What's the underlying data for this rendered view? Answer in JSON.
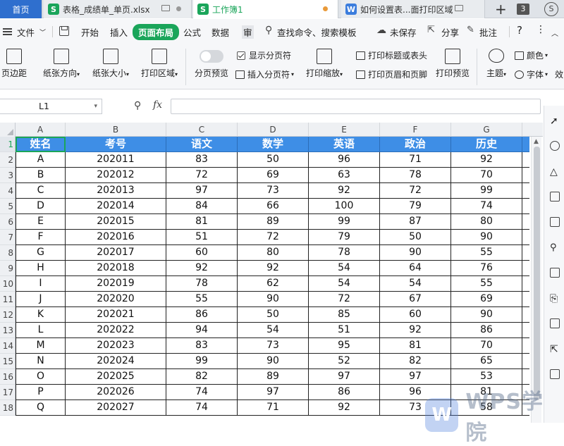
{
  "tabs": {
    "home": "首页",
    "file1": "表格_成绩单_单页.xlsx",
    "file2": "工作簿1",
    "file3": "如何设置表...面打印区域",
    "count": "3",
    "user_initial": "S"
  },
  "menu": {
    "file": "文件",
    "start": "开始",
    "insert": "插入",
    "layout": "页面布局",
    "formula": "公式",
    "data": "数据",
    "more": "审",
    "search": "查找命令、搜索模板",
    "unsaved": "未保存",
    "share": "分享",
    "comment": "批注",
    "help": "?"
  },
  "ribbon": {
    "margins": "页边距",
    "orientation": "纸张方向",
    "size": "纸张大小",
    "print_area": "打印区域",
    "page_break_preview": "分页预览",
    "show_page_break": "显示分页符",
    "insert_page_break": "插入分页符",
    "print_scale": "打印缩放",
    "print_titles": "打印标题或表头",
    "print_header_footer": "打印页眉和页脚",
    "print_preview": "打印预览",
    "theme": "主题",
    "colors": "颜色",
    "font": "字体",
    "effects": "效"
  },
  "formula_bar": {
    "cell_ref": "L1",
    "fx": "fx",
    "value": ""
  },
  "columns": [
    "A",
    "B",
    "C",
    "D",
    "E",
    "F",
    "G"
  ],
  "row_numbers": [
    "1",
    "2",
    "3",
    "4",
    "5",
    "6",
    "7",
    "8",
    "9",
    "10",
    "11",
    "12",
    "13",
    "14",
    "15",
    "16",
    "17",
    "18"
  ],
  "table": {
    "headers": [
      "姓名",
      "考号",
      "语文",
      "数学",
      "英语",
      "政治",
      "历史"
    ],
    "rows": [
      [
        "A",
        "202011",
        "83",
        "50",
        "96",
        "71",
        "92"
      ],
      [
        "B",
        "202012",
        "72",
        "69",
        "63",
        "78",
        "70"
      ],
      [
        "C",
        "202013",
        "97",
        "73",
        "92",
        "72",
        "99"
      ],
      [
        "D",
        "202014",
        "84",
        "66",
        "100",
        "79",
        "74"
      ],
      [
        "E",
        "202015",
        "81",
        "89",
        "99",
        "87",
        "80"
      ],
      [
        "F",
        "202016",
        "51",
        "72",
        "79",
        "50",
        "90"
      ],
      [
        "G",
        "202017",
        "60",
        "80",
        "78",
        "90",
        "55"
      ],
      [
        "H",
        "202018",
        "92",
        "92",
        "54",
        "64",
        "76"
      ],
      [
        "I",
        "202019",
        "78",
        "62",
        "54",
        "54",
        "55"
      ],
      [
        "J",
        "202020",
        "55",
        "90",
        "72",
        "67",
        "69"
      ],
      [
        "K",
        "202021",
        "86",
        "50",
        "85",
        "60",
        "90"
      ],
      [
        "L",
        "202022",
        "94",
        "54",
        "51",
        "92",
        "86"
      ],
      [
        "M",
        "202023",
        "83",
        "73",
        "95",
        "81",
        "70"
      ],
      [
        "N",
        "202024",
        "99",
        "90",
        "52",
        "82",
        "65"
      ],
      [
        "O",
        "202025",
        "82",
        "89",
        "97",
        "97",
        "53"
      ],
      [
        "P",
        "202026",
        "74",
        "97",
        "86",
        "96",
        "81"
      ],
      [
        "Q",
        "202027",
        "74",
        "71",
        "92",
        "73",
        "58"
      ]
    ]
  },
  "watermark": {
    "logo": "W",
    "text": "WPS学院"
  },
  "colors": {
    "header_fill": "#3e8ee6",
    "accent_green": "#1aa55a",
    "home_tab": "#2f6fce"
  }
}
